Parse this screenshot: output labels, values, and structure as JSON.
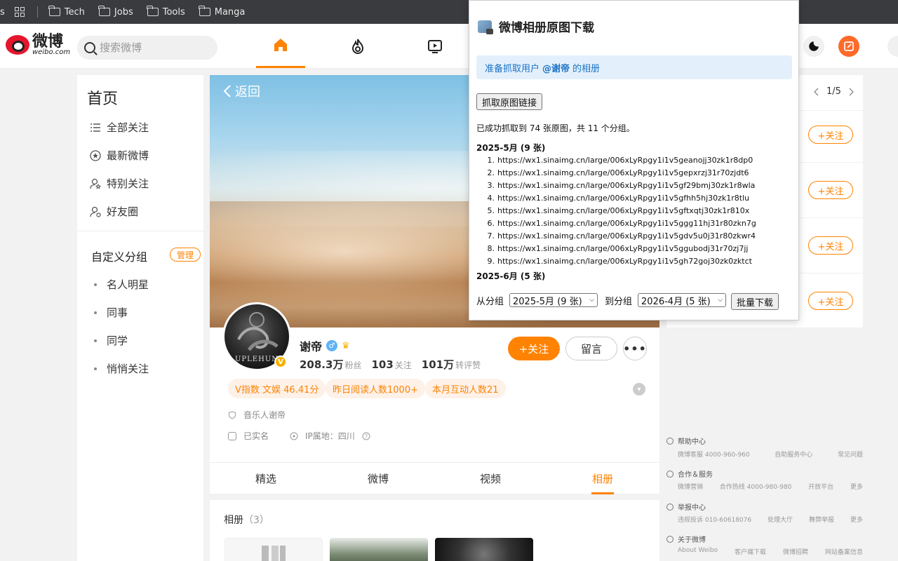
{
  "bookmarks": {
    "items": [
      "Tech",
      "Jobs",
      "Tools",
      "Manga"
    ],
    "left_fragment": "s"
  },
  "header": {
    "logo_cn": "微博",
    "logo_en": "weibo.com",
    "search_placeholder": "搜索微博"
  },
  "sidebar": {
    "title": "首页",
    "items": [
      {
        "label": "全部关注",
        "icon": "list-icon"
      },
      {
        "label": "最新微博",
        "icon": "star-icon"
      },
      {
        "label": "特别关注",
        "icon": "user-star-icon"
      },
      {
        "label": "好友圈",
        "icon": "friends-icon"
      }
    ],
    "group_title": "自定义分组",
    "manage_label": "管理",
    "groups": [
      "名人明星",
      "同事",
      "同学",
      "悄悄关注"
    ]
  },
  "cover": {
    "back_label": "返回"
  },
  "profile": {
    "name": "谢帝",
    "avatar_text": "UPLEHUN",
    "verified_badge": "V",
    "gender_symbol": "♂",
    "crown_symbol": "♛",
    "stats": [
      {
        "value": "208.3万",
        "label": "粉丝"
      },
      {
        "value": "103",
        "label": "关注"
      },
      {
        "value": "101万",
        "label": "转评赞"
      }
    ],
    "follow_label": "+关注",
    "message_label": "留言",
    "more_label": "•••",
    "tags": [
      "V指数 文娱 46.41分",
      "昨日阅读人数1000+",
      "本月互动人数21"
    ],
    "bio": "音乐人谢帝",
    "realname": "已实名",
    "ip_location": "IP属地：四川"
  },
  "tabs": [
    "精选",
    "微博",
    "视频",
    "相册"
  ],
  "album": {
    "title": "相册",
    "count": "（3）"
  },
  "right_panel": {
    "pager": "1/5",
    "follow_label": "+关注"
  },
  "footer": {
    "sections": [
      {
        "title": "帮助中心",
        "links": [
          "微博客服 4000-960-960",
          "自助服务中心",
          "常见问题"
        ]
      },
      {
        "title": "合作＆服务",
        "links": [
          "微博营销",
          "合作热线 4000-980-980",
          "开放平台",
          "更多"
        ]
      },
      {
        "title": "举报中心",
        "links": [
          "违规投诉 010-60618076",
          "处理大厅",
          "舞弊举报",
          "更多"
        ]
      },
      {
        "title": "关于微博",
        "links": [
          "About Weibo",
          "客户端下载",
          "微博招聘",
          "网站备案信息"
        ]
      }
    ]
  },
  "popup": {
    "title": "微博相册原图下载",
    "notice_prefix": "准备抓取用户",
    "notice_user": "@谢帝",
    "notice_suffix": "的相册",
    "fetch_button": "抓取原图链接",
    "success_text": "已成功抓取到 74 张原图，共 11 个分组。",
    "group1": "2025-5月 (9 张)",
    "links": [
      "https://wx1.sinaimg.cn/large/006xLyRpgy1i1v5geanojj30zk1r8dp0",
      "https://wx1.sinaimg.cn/large/006xLyRpgy1i1v5gepxrzj31r70zjdt6",
      "https://wx1.sinaimg.cn/large/006xLyRpgy1i1v5gf29bmj30zk1r8wla",
      "https://wx1.sinaimg.cn/large/006xLyRpgy1i1v5gfhh5hj30zk1r8tlu",
      "https://wx1.sinaimg.cn/large/006xLyRpgy1i1v5gftxqtj30zk1r810x",
      "https://wx1.sinaimg.cn/large/006xLyRpgy1i1v5ggg11hj31r80zkn7g",
      "https://wx1.sinaimg.cn/large/006xLyRpgy1i1v5gdv5u0j31r80zkwr4",
      "https://wx1.sinaimg.cn/large/006xLyRpgy1i1v5ggubodj31r70zj7jj",
      "https://wx1.sinaimg.cn/large/006xLyRpgy1i1v5gh72goj30zk0zktct"
    ],
    "group2": "2025-6月 (5 张)",
    "from_label": "从分组",
    "from_value": "2025-5月 (9 张)",
    "to_label": "到分组",
    "to_value": "2026-4月 (5 张)",
    "download_button": "批量下载"
  },
  "colors": {
    "accent": "#ff8200",
    "notice_bg": "#e3f0fc",
    "notice_text": "#1a72c4"
  }
}
